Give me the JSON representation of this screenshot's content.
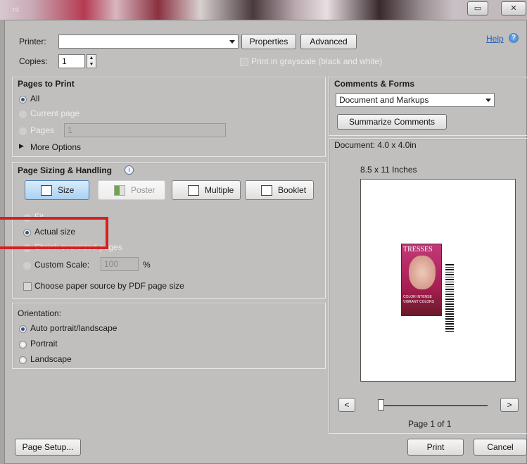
{
  "window": {
    "title": "nt",
    "restore_label": "▭",
    "close_label": "✕"
  },
  "header": {
    "printer_label": "Printer:",
    "printer_value": "",
    "properties_label": "Properties",
    "advanced_label": "Advanced",
    "help_label": "Help",
    "copies_label": "Copies:",
    "copies_value": "1",
    "grayscale_label": "Print in grayscale (black and white)"
  },
  "pages_to_print": {
    "title": "Pages to Print",
    "all_label": "All",
    "current_label": "Current page",
    "pages_label": "Pages",
    "pages_value": "1",
    "more_label": "More Options"
  },
  "sizing": {
    "title": "Page Sizing & Handling",
    "buttons": [
      "Size",
      "Poster",
      "Multiple",
      "Booklet"
    ],
    "fit_label": "Fit",
    "actual_label": "Actual size",
    "shrink_label": "Shrink oversized pages",
    "custom_label": "Custom Scale:",
    "custom_value": "100",
    "percent_label": "%",
    "paper_source_label": "Choose paper source by PDF page size"
  },
  "orientation": {
    "title": "Orientation:",
    "auto_label": "Auto portrait/landscape",
    "portrait_label": "Portrait",
    "landscape_label": "Landscape"
  },
  "comments": {
    "title": "Comments & Forms",
    "select_value": "Document and Markups",
    "summarize_label": "Summarize Comments"
  },
  "preview": {
    "document_label": "Document: 4.0 x 4.0in",
    "paper_label": "8.5 x 11 Inches",
    "magazine_title": "TRESSES",
    "magazine_caption_line1": "COLOR INTENSE",
    "magazine_caption_line2": "VIBRANT COLORS",
    "prev_label": "<",
    "next_label": ">",
    "page_status": "Page 1 of 1"
  },
  "footer": {
    "page_setup_label": "Page Setup...",
    "print_label": "Print",
    "cancel_label": "Cancel"
  },
  "colors": {
    "accent": "#2f6fbf",
    "highlight_box": "#d62020",
    "dialog_bg": "#c0bfbd"
  }
}
